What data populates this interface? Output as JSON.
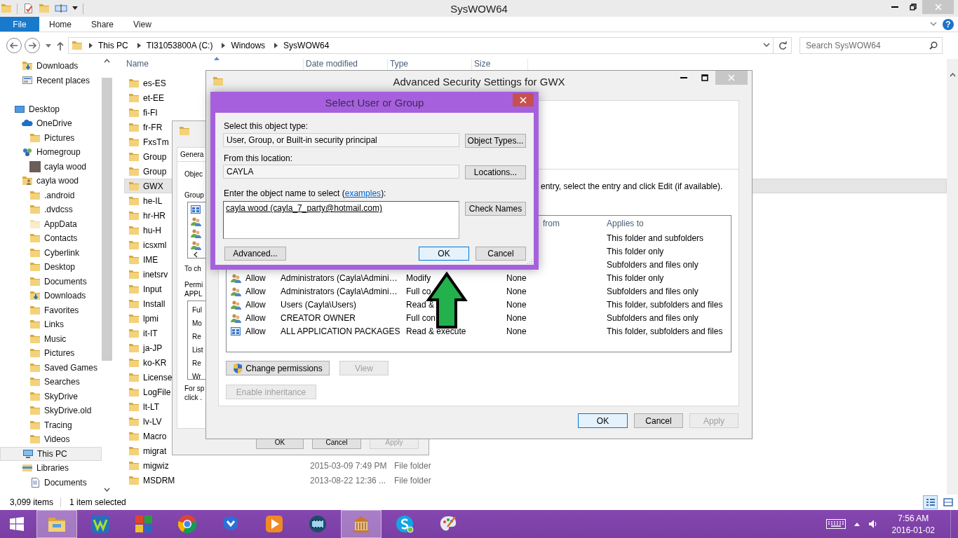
{
  "explorer": {
    "title": "SysWOW64",
    "file_tab": "File",
    "ribbon_tabs": [
      "Home",
      "Share",
      "View"
    ],
    "help": "?",
    "breadcrumb": [
      "This PC",
      "TI31053800A (C:)",
      "Windows",
      "SysWOW64"
    ],
    "search": {
      "placeholder": "Search SysWOW64"
    },
    "nav": {
      "favorites": [
        {
          "label": "Downloads",
          "kind": "downloads",
          "selected": false
        },
        {
          "label": "Recent places",
          "kind": "recent",
          "selected": false
        }
      ],
      "tree": [
        {
          "label": "Desktop",
          "kind": "desktop",
          "selected": false,
          "children": [
            {
              "label": "OneDrive",
              "kind": "cloud",
              "selected": false,
              "children": [
                {
                  "label": "Pictures",
                  "kind": "folder",
                  "selected": false
                }
              ]
            },
            {
              "label": "Homegroup",
              "kind": "homegroup",
              "selected": false,
              "children": [
                {
                  "label": "cayla wood",
                  "kind": "avatar",
                  "selected": false
                }
              ]
            },
            {
              "label": "cayla wood",
              "kind": "userfolder",
              "selected": false,
              "children": [
                {
                  "label": ".android",
                  "kind": "folder",
                  "selected": false
                },
                {
                  "label": ".dvdcss",
                  "kind": "folder",
                  "selected": false
                },
                {
                  "label": "AppData",
                  "kind": "hidden-folder",
                  "selected": false
                },
                {
                  "label": "Contacts",
                  "kind": "folder",
                  "selected": false
                },
                {
                  "label": "Cyberlink",
                  "kind": "folder",
                  "selected": false
                },
                {
                  "label": "Desktop",
                  "kind": "folder",
                  "selected": false
                },
                {
                  "label": "Documents",
                  "kind": "folder",
                  "selected": false
                },
                {
                  "label": "Downloads",
                  "kind": "downloads",
                  "selected": false
                },
                {
                  "label": "Favorites",
                  "kind": "folder",
                  "selected": false
                },
                {
                  "label": "Links",
                  "kind": "folder",
                  "selected": false
                },
                {
                  "label": "Music",
                  "kind": "folder",
                  "selected": false
                },
                {
                  "label": "Pictures",
                  "kind": "folder",
                  "selected": false
                },
                {
                  "label": "Saved Games",
                  "kind": "folder",
                  "selected": false
                },
                {
                  "label": "Searches",
                  "kind": "folder",
                  "selected": false
                },
                {
                  "label": "SkyDrive",
                  "kind": "folder",
                  "selected": false
                },
                {
                  "label": "SkyDrive.old",
                  "kind": "folder",
                  "selected": false
                },
                {
                  "label": "Tracing",
                  "kind": "folder",
                  "selected": false
                },
                {
                  "label": "Videos",
                  "kind": "folder",
                  "selected": false
                }
              ]
            },
            {
              "label": "This PC",
              "kind": "pc",
              "selected": true
            },
            {
              "label": "Libraries",
              "kind": "library",
              "selected": false,
              "children": [
                {
                  "label": "Documents",
                  "kind": "doc",
                  "selected": false
                }
              ]
            }
          ]
        }
      ]
    },
    "columns": [
      "Name",
      "Date modified",
      "Type",
      "Size"
    ],
    "files": [
      {
        "name": "es-ES",
        "selected": false
      },
      {
        "name": "et-EE",
        "selected": false
      },
      {
        "name": "fi-FI",
        "selected": false
      },
      {
        "name": "fr-FR",
        "selected": false
      },
      {
        "name": "FxsTm",
        "selected": false
      },
      {
        "name": "Group",
        "selected": false
      },
      {
        "name": "Group",
        "selected": false
      },
      {
        "name": "GWX",
        "selected": true
      },
      {
        "name": "he-IL",
        "selected": false
      },
      {
        "name": "hr-HR",
        "selected": false
      },
      {
        "name": "hu-H",
        "selected": false
      },
      {
        "name": "icsxml",
        "selected": false
      },
      {
        "name": "IME",
        "selected": false
      },
      {
        "name": "inetsrv",
        "selected": false
      },
      {
        "name": "Input",
        "selected": false
      },
      {
        "name": "Install",
        "selected": false
      },
      {
        "name": "lpmi",
        "selected": false
      },
      {
        "name": "it-IT",
        "selected": false
      },
      {
        "name": "ja-JP",
        "selected": false
      },
      {
        "name": "ko-KR",
        "selected": false
      },
      {
        "name": "License",
        "selected": false
      },
      {
        "name": "LogFile",
        "selected": false
      },
      {
        "name": "lt-LT",
        "selected": false
      },
      {
        "name": "lv-LV",
        "selected": false
      },
      {
        "name": "Macro",
        "selected": false
      },
      {
        "name": "migrat",
        "selected": false
      },
      {
        "name": "migwiz",
        "date": "2015-03-09 7:49 PM",
        "type": "File folder",
        "selected": false
      },
      {
        "name": "MSDRM",
        "date": "2013-08-22 12:36 ...",
        "type": "File folder",
        "selected": false
      }
    ],
    "status": {
      "count": "3,099 items",
      "selection": "1 item selected",
      "views": [
        {
          "kind": "details",
          "selected": true
        },
        {
          "kind": "tiles",
          "selected": false
        }
      ]
    }
  },
  "properties_window": {
    "tab": "Genera",
    "object_label": "Objec",
    "group_label": "Group",
    "group_entries": [
      {
        "kind": "package"
      },
      {
        "kind": "group"
      },
      {
        "kind": "group"
      },
      {
        "kind": "group"
      }
    ],
    "change_hint": "To ch",
    "permissions_label": [
      "Permi",
      "APPL"
    ],
    "permissions": [
      "Ful",
      "Mo",
      "Re",
      "List",
      "Re",
      "Wr"
    ],
    "special_hint": [
      "For sp",
      "click ."
    ],
    "buttons": [
      {
        "label": "OK",
        "disabled": false
      },
      {
        "label": "Cancel",
        "disabled": false
      },
      {
        "label": "Apply",
        "disabled": true
      }
    ]
  },
  "advanced_security": {
    "title": "Advanced Security Settings for GWX",
    "instruction": "entry, select the entry and click Edit (if available).",
    "columns": [
      "from",
      "Applies to"
    ],
    "entries": [
      {
        "applies": "This folder and subfolders"
      },
      {
        "applies": "This folder only"
      },
      {
        "applies": "Subfolders and files only"
      },
      {
        "kind": "group",
        "type": "Allow",
        "principal": "Administrators (Cayla\\Admini…",
        "access": "Modify",
        "inherited": "None",
        "applies": "This folder only"
      },
      {
        "kind": "group",
        "type": "Allow",
        "principal": "Administrators (Cayla\\Admini…",
        "access": "Full co",
        "inherited": "None",
        "applies": "Subfolders and files only"
      },
      {
        "kind": "group",
        "type": "Allow",
        "principal": "Users (Cayla\\Users)",
        "access": "Read &",
        "inherited": "None",
        "applies": "This folder, subfolders and files"
      },
      {
        "kind": "group",
        "type": "Allow",
        "principal": "CREATOR OWNER",
        "access": "Full con",
        "inherited": "None",
        "applies": "Subfolders and files only"
      },
      {
        "kind": "package",
        "type": "Allow",
        "principal": "ALL APPLICATION PACKAGES",
        "access": "Read & execute",
        "inherited": "None",
        "applies": "This folder, subfolders and files"
      }
    ],
    "actions": [
      {
        "label": "Change permissions",
        "kind": "elevated",
        "disabled": false
      },
      {
        "label": "View",
        "kind": "plain",
        "disabled": true
      },
      {
        "label": "Enable inheritance",
        "kind": "plain",
        "disabled": true
      }
    ],
    "buttons": [
      {
        "label": "OK",
        "default": true,
        "disabled": false
      },
      {
        "label": "Cancel",
        "default": false,
        "disabled": false
      },
      {
        "label": "Apply",
        "default": false,
        "disabled": true
      }
    ]
  },
  "select_user": {
    "title": "Select User or Group",
    "object_type_label": "Select this object type:",
    "object_type": "User, Group, or Built-in security principal",
    "object_types_button": "Object Types...",
    "location_label": "From this location:",
    "location": "CAYLA",
    "locations_button": "Locations...",
    "name_label": {
      "before": "Enter the object name to select (",
      "link": "examples",
      "after": "):"
    },
    "name_value": "cayla wood (cayla_7_party@hotmail.com)",
    "check_names_button": "Check Names",
    "advanced_button": "Advanced...",
    "buttons": [
      {
        "label": "OK",
        "default": true
      },
      {
        "label": "Cancel",
        "default": false
      }
    ]
  },
  "taskbar": {
    "apps": [
      {
        "kind": "folder",
        "active": true
      },
      {
        "kind": "zigzag",
        "active": false
      },
      {
        "kind": "squares",
        "active": false
      },
      {
        "kind": "ball",
        "active": false
      },
      {
        "kind": "badge",
        "active": false
      },
      {
        "kind": "play",
        "active": false
      },
      {
        "kind": "film",
        "active": false
      },
      {
        "kind": "building",
        "active": true
      },
      {
        "kind": "round",
        "active": false
      },
      {
        "kind": "palette",
        "active": false
      }
    ],
    "time": "7:56 AM",
    "date": "2016-01-02"
  }
}
